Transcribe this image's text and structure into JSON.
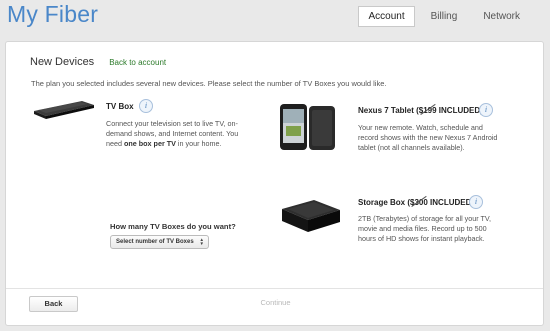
{
  "header": {
    "app_title": "My Fiber"
  },
  "nav": {
    "tabs": [
      {
        "label": "Account",
        "active": true
      },
      {
        "label": "Billing"
      },
      {
        "label": "Network"
      }
    ]
  },
  "page": {
    "title": "New Devices",
    "back_link": "Back to account",
    "intro": "The plan you selected includes several new devices. Please select the number of TV Boxes you would like."
  },
  "devices": {
    "tv_box": {
      "name": "TV Box",
      "desc_1": "Connect your television set to live TV, on-",
      "desc_2": "demand shows, and Internet content. You",
      "desc_3_pre": "need ",
      "desc_3_bold": "one box per TV",
      "desc_3_post": " in your home."
    },
    "nexus": {
      "name_pre": "Nexus 7 Tablet (",
      "price": "$199",
      "name_post": " INCLUDED)",
      "desc_1": "Your new remote. Watch, schedule and",
      "desc_2": "record shows with the new Nexus 7 Android",
      "desc_3": "tablet (not all channels available)."
    },
    "storage": {
      "name_pre": "Storage Box (",
      "price": "$300",
      "name_post": " INCLUDED)",
      "desc_1": "2TB (Terabytes) of storage for all your TV,",
      "desc_2": "movie and media files. Record up to 500",
      "desc_3": "hours of HD shows for instant playback."
    },
    "info_icon": "i"
  },
  "selector": {
    "question": "How many TV Boxes do you want?",
    "selected": "Select number of TV Boxes"
  },
  "footer": {
    "back_label": "Back",
    "continue_label": "Continue"
  }
}
